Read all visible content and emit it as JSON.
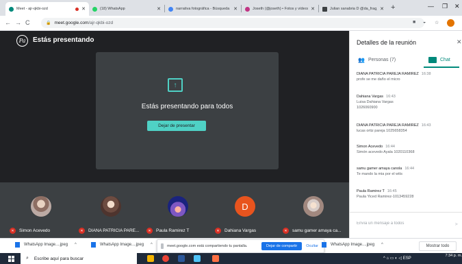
{
  "browser": {
    "tabs": [
      {
        "title": "Meet - ajr-qkbi-ozd",
        "active": true,
        "recording": true
      },
      {
        "title": "(18) WhatsApp"
      },
      {
        "title": "narrativa fotográfica - Búsqueda"
      },
      {
        "title": "Joseth (@joseth) • Fotos y vídeos"
      },
      {
        "title": "Julian sanabria D @da_frag_..."
      }
    ],
    "new_tab_label": "+",
    "url_host": "meet.google.com",
    "url_path": "/ajr-qkbi-ozd"
  },
  "meet": {
    "header_title": "Estás presentando",
    "presenting_text": "Estás presentando para todos",
    "stop_button": "Dejar de presentar",
    "participants": [
      {
        "name": "Simon Acevedo"
      },
      {
        "name": "DIANA PATRICIA PARE..."
      },
      {
        "name": "Paula Ramirez T"
      },
      {
        "name": "Dahiana Vargas",
        "initial": "D"
      },
      {
        "name": "samu gamer amaya ca..."
      }
    ]
  },
  "panel": {
    "title": "Detalles de la reunión",
    "tab_people": "Personas (7)",
    "tab_chat": "Chat",
    "messages": [
      {
        "sender": "DIANA PATRICIA PAREJA RAMIREZ",
        "time": "16:38",
        "lines": [
          "profe se me daño el micro"
        ]
      },
      {
        "sender": "Dahiana Vargas",
        "time": "16:43",
        "lines": [
          "Luisa Dahiana Vargas",
          "1026060900"
        ]
      },
      {
        "sender": "DIANA PATRICIA PAREJA RAMIREZ",
        "time": "16:43",
        "lines": [
          "lucas ortiz pareja 1025658354"
        ]
      },
      {
        "sender": "Simon Acevedo",
        "time": "16:44",
        "lines": [
          "Simón acevedo Ayala 1020110368"
        ]
      },
      {
        "sender": "samu gamer amaya canola",
        "time": "16:44",
        "lines": [
          "Te mando la mia por el wtts"
        ]
      },
      {
        "sender": "Paula Ramirez T",
        "time": "16:45",
        "lines": [
          "Paula Yiced Ramirez-1013459228"
        ]
      }
    ],
    "compose_placeholder": "Envía un mensaje a todos"
  },
  "downloads": {
    "items": [
      "WhatsApp Image....jpeg",
      "WhatsApp Image....jpeg",
      "WhatsApp Image....jpeg"
    ],
    "share_message": "meet.google.com está compartiendo tu pantalla.",
    "share_stop": "Dejar de compartir",
    "share_hide": "Ocultar",
    "show_all": "Mostrar todo"
  },
  "taskbar": {
    "search_placeholder": "Escribe aquí para buscar",
    "language": "ESP",
    "time": "7:34 p. m."
  },
  "colors": {
    "accent": "#4fd1c5",
    "meet_bg": "#202124",
    "mic_off": "#d93025",
    "chat_teal": "#00897b"
  }
}
